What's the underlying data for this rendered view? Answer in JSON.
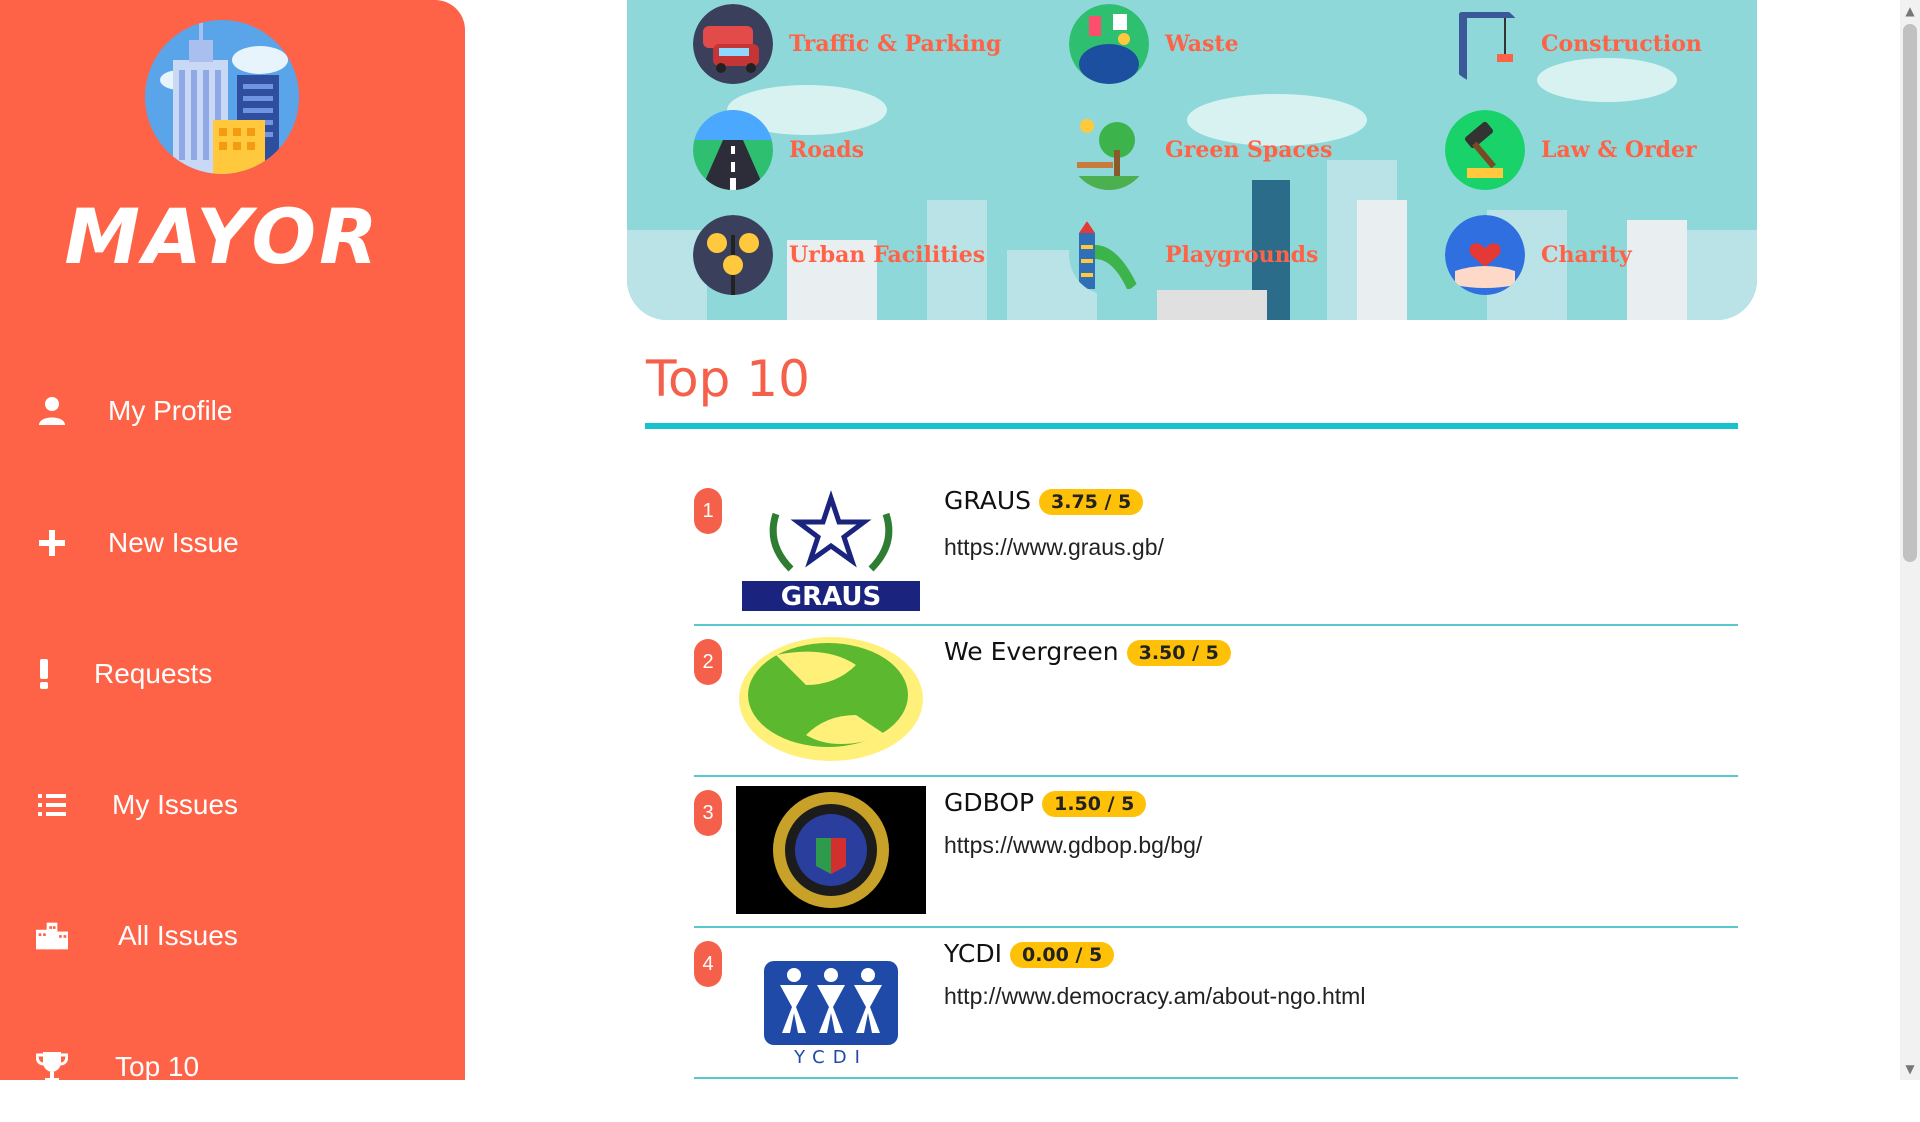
{
  "app": {
    "title": "MAYOR"
  },
  "sidebar": {
    "items": [
      {
        "label": "My Profile",
        "icon": "user-icon"
      },
      {
        "label": "New Issue",
        "icon": "plus-icon"
      },
      {
        "label": "Requests",
        "icon": "exclamation-icon"
      },
      {
        "label": "My Issues",
        "icon": "list-icon"
      },
      {
        "label": "All Issues",
        "icon": "city-icon"
      },
      {
        "label": "Top 10",
        "icon": "trophy-icon"
      }
    ]
  },
  "categories": [
    {
      "label": "Traffic & Parking",
      "icon": "traffic-icon"
    },
    {
      "label": "Waste",
      "icon": "waste-icon"
    },
    {
      "label": "Construction",
      "icon": "crane-icon"
    },
    {
      "label": "Roads",
      "icon": "road-icon"
    },
    {
      "label": "Green Spaces",
      "icon": "park-icon"
    },
    {
      "label": "Law & Order",
      "icon": "gavel-icon"
    },
    {
      "label": "Urban Facilities",
      "icon": "lamp-icon"
    },
    {
      "label": "Playgrounds",
      "icon": "slide-icon"
    },
    {
      "label": "Charity",
      "icon": "heart-hands-icon"
    }
  ],
  "top10": {
    "title": "Top 10",
    "items": [
      {
        "rank": "1",
        "name": "GRAUS",
        "rating": "3.75 / 5",
        "url": "https://www.graus.gb/",
        "logo_text": "GRAUS"
      },
      {
        "rank": "2",
        "name": "We Evergreen",
        "rating": "3.50 / 5",
        "url": ""
      },
      {
        "rank": "3",
        "name": "GDBOP",
        "rating": "1.50 / 5",
        "url": "https://www.gdbop.bg/bg/"
      },
      {
        "rank": "4",
        "name": "YCDI",
        "rating": "0.00 / 5",
        "url": "http://www.democracy.am/about-ngo.html",
        "logo_text": "YCDI"
      }
    ]
  },
  "colors": {
    "sidebar": "#ff6347",
    "accent": "#16c2cc",
    "badge": "#ffc107",
    "banner": "#8fd8d9"
  }
}
